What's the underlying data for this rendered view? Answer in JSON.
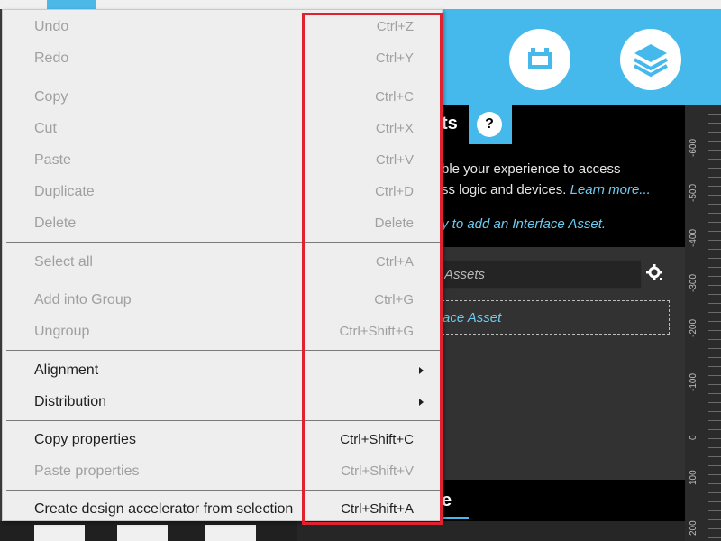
{
  "panel": {
    "title_fragment": "ts",
    "help_label": "?",
    "description_line1": "ble your experience to access",
    "description_line2_prefix": "ss logic and devices. ",
    "learn_more": "Learn more...",
    "add_hint": "y to add an Interface Asset.",
    "search_placeholder": "Assets",
    "dropzone_text": "ace Asset",
    "bottom_title_fragment": "e"
  },
  "ruler": {
    "labels": [
      "-600",
      "-500",
      "-400",
      "-300",
      "-200",
      "-100",
      "0",
      "100",
      "200"
    ]
  },
  "menu": {
    "items": [
      {
        "label": "Undo",
        "shortcut": "Ctrl+Z",
        "enabled": false
      },
      {
        "label": "Redo",
        "shortcut": "Ctrl+Y",
        "enabled": false
      },
      {
        "label": "Copy",
        "shortcut": "Ctrl+C",
        "enabled": false
      },
      {
        "label": "Cut",
        "shortcut": "Ctrl+X",
        "enabled": false
      },
      {
        "label": "Paste",
        "shortcut": "Ctrl+V",
        "enabled": false
      },
      {
        "label": "Duplicate",
        "shortcut": "Ctrl+D",
        "enabled": false
      },
      {
        "label": "Delete",
        "shortcut": "Delete",
        "enabled": false
      },
      {
        "label": "Select all",
        "shortcut": "Ctrl+A",
        "enabled": false
      },
      {
        "label": "Add into Group",
        "shortcut": "Ctrl+G",
        "enabled": false
      },
      {
        "label": "Ungroup",
        "shortcut": "Ctrl+Shift+G",
        "enabled": false
      },
      {
        "label": "Alignment",
        "shortcut": "",
        "enabled": true,
        "submenu": true
      },
      {
        "label": "Distribution",
        "shortcut": "",
        "enabled": true,
        "submenu": true
      },
      {
        "label": "Copy properties",
        "shortcut": "Ctrl+Shift+C",
        "enabled": true
      },
      {
        "label": "Paste properties",
        "shortcut": "Ctrl+Shift+V",
        "enabled": false
      },
      {
        "label": "Create design accelerator from selection",
        "shortcut": "Ctrl+Shift+A",
        "enabled": true
      }
    ]
  },
  "colors": {
    "accent_blue": "#46b9ec",
    "highlight_red": "#e0212f",
    "menu_bg": "#eeeeee",
    "link_blue": "#6ccbf2"
  },
  "icons": {
    "header_left": "battery-icon",
    "header_right": "layers-icon",
    "search_settings": "gear-icon"
  }
}
